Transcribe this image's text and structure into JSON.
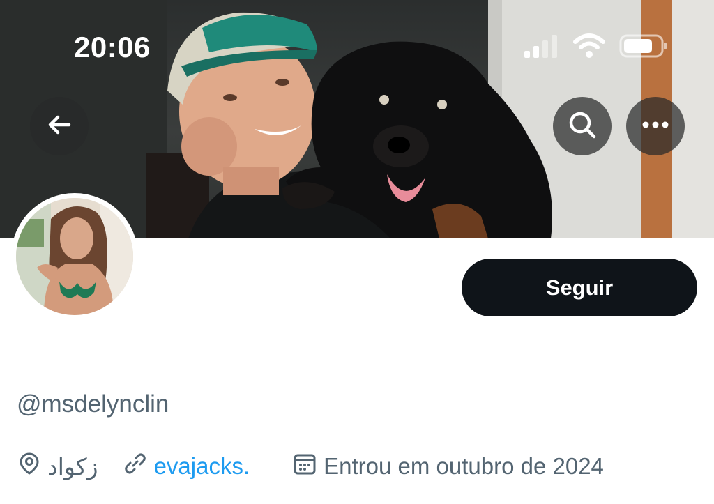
{
  "status_bar": {
    "time": "20:06",
    "icons": [
      "cellular-signal-icon",
      "wifi-icon",
      "battery-icon"
    ]
  },
  "header_actions": {
    "back_icon": "arrow-left-icon",
    "search_icon": "search-icon",
    "more_icon": "more-horizontal-icon"
  },
  "profile": {
    "follow_label": "Seguir",
    "handle": "@msdelynclin",
    "location": "زكواد",
    "website": "evajacks.",
    "joined": "Entrou em outubro de 2024"
  },
  "colors": {
    "primary_text": "#0f1419",
    "secondary_text": "#536471",
    "link": "#1d9bf0",
    "button_bg": "#0f1419"
  }
}
